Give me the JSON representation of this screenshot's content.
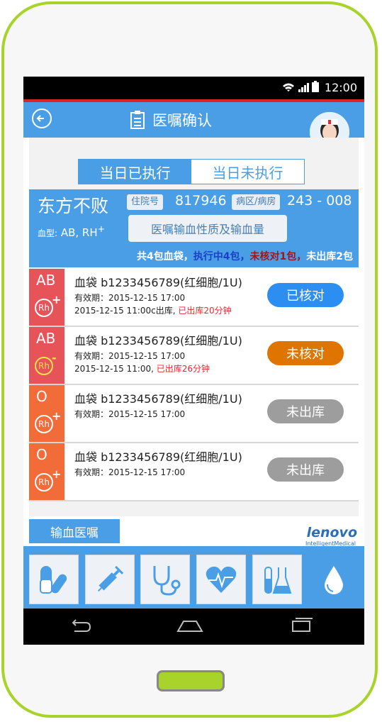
{
  "status": {
    "time": "12:00"
  },
  "header": {
    "title": "医嘱确认"
  },
  "tabs": {
    "executed": "当日已执行",
    "not_executed": "当日未执行"
  },
  "patient": {
    "name": "东方不败",
    "admission_tag": "住院号",
    "admission_no": "817946",
    "ward_tag": "病区/病房",
    "ward_no": "243 - 008",
    "blood_label": "血型:",
    "blood_type": "AB, RH",
    "rh_sup": "+",
    "query_button": "医嘱输血性质及输血量",
    "summary_total": "共4包血袋，",
    "summary_executing": "执行中4包，",
    "summary_unverified": "未核对1包，",
    "summary_not_out": "未出库2包"
  },
  "bags": [
    {
      "blood_type": "AB",
      "rh": "Rh",
      "rh_sign": "+",
      "name": "血袋 b1233456789(红细胞/1U)",
      "expiry": "有效期：2015-12-15 17:00",
      "out": "2015-12-15 11:00c出库,",
      "out_warn": "已出库20分钟",
      "status": "已核对",
      "status_color": "#2c8ef0"
    },
    {
      "blood_type": "AB",
      "rh": "Rh",
      "rh_sign": "-",
      "name": "血袋 b1233456789(红细胞/1U)",
      "expiry": "有效期：2015-12-15 17:00",
      "out": "2015-12-15 11:00,",
      "out_warn": "已出库26分钟",
      "status": "未核对",
      "status_color": "#e07400"
    },
    {
      "blood_type": "O",
      "rh": "Rh",
      "rh_sign": "+",
      "name": "血袋 b1233456789(红细胞/1U)",
      "expiry": "有效期：2015-12-15 17:00",
      "status": "未出库",
      "status_color": "#9d9d9d"
    },
    {
      "blood_type": "O",
      "rh": "Rh",
      "rh_sign": "+",
      "name": "血袋 b1233456789(红细胞/1U)",
      "expiry": "有效期：2015-12-15 17:00",
      "status": "未出库",
      "status_color": "#9d9d9d"
    }
  ],
  "footer": {
    "order_button": "输血医嘱",
    "logo": "lenovo",
    "logo_sub": "IntelligentMedical"
  },
  "toolbar": {
    "icons": [
      "medicine-icon",
      "syringe-icon",
      "stethoscope-icon",
      "heart-monitor-icon",
      "lab-flask-icon",
      "blood-drop-icon"
    ]
  },
  "colors": {
    "primary": "#4a9ee6",
    "phone_frame": "#a8d32a",
    "accent_red": "#e8282d"
  }
}
